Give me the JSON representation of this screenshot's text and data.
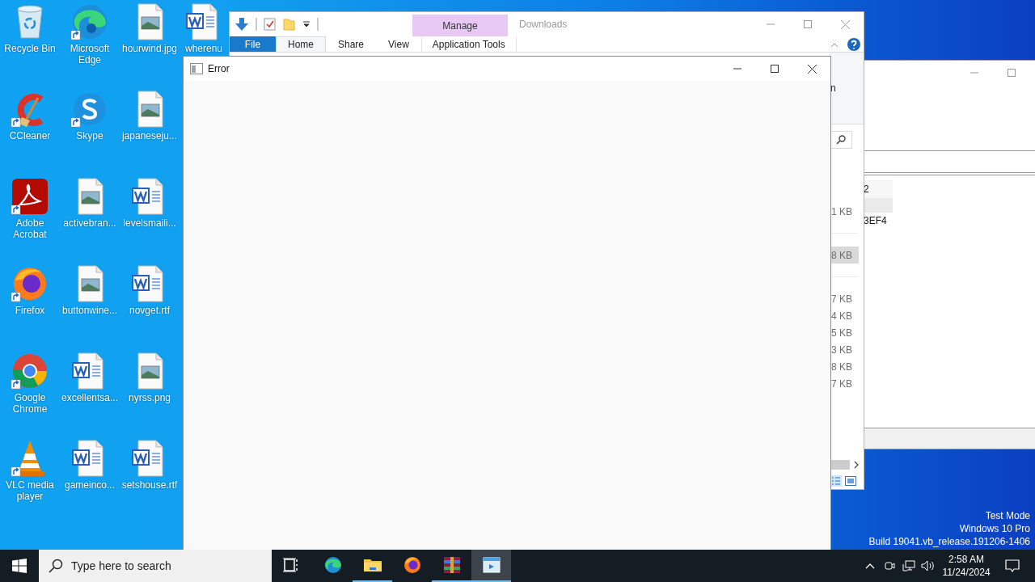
{
  "desktop": {
    "icons": [
      {
        "label": "Recycle Bin",
        "kind": "recycle",
        "shortcut": false
      },
      {
        "label": "CCleaner",
        "kind": "ccleaner",
        "shortcut": true
      },
      {
        "label": "Adobe Acrobat",
        "kind": "acrobat",
        "shortcut": true
      },
      {
        "label": "Firefox",
        "kind": "firefox",
        "shortcut": true
      },
      {
        "label": "Google Chrome",
        "kind": "chrome",
        "shortcut": true
      },
      {
        "label": "VLC media player",
        "kind": "vlc",
        "shortcut": true
      },
      {
        "label": "Microsoft Edge",
        "kind": "edge",
        "shortcut": true
      },
      {
        "label": "Skype",
        "kind": "skype",
        "shortcut": true
      },
      {
        "label": "activebran...",
        "kind": "image",
        "shortcut": false
      },
      {
        "label": "buttonwine...",
        "kind": "image",
        "shortcut": false
      },
      {
        "label": "excellentsa...",
        "kind": "word",
        "shortcut": false
      },
      {
        "label": "gameinco...",
        "kind": "word",
        "shortcut": false
      },
      {
        "label": "hourwind.jpg",
        "kind": "image",
        "shortcut": false
      },
      {
        "label": "japaneseju...",
        "kind": "image",
        "shortcut": false
      },
      {
        "label": "levelsmaili...",
        "kind": "word",
        "shortcut": false
      },
      {
        "label": "novget.rtf",
        "kind": "word",
        "shortcut": false
      },
      {
        "label": "nyrss.png",
        "kind": "image",
        "shortcut": false
      },
      {
        "label": "setshouse.rtf",
        "kind": "word",
        "shortcut": false
      },
      {
        "label": "wherenu",
        "kind": "word",
        "shortcut": false
      }
    ],
    "info": [
      "Test Mode",
      "Windows 10 Pro",
      "Build 19041.vb_release.191206-1406"
    ]
  },
  "explorer": {
    "context_tab": "Manage",
    "title": "Downloads",
    "tabs": [
      {
        "label": "File",
        "kind": "file",
        "selected": false
      },
      {
        "label": "Home",
        "kind": "plain",
        "selected": true
      },
      {
        "label": "Share",
        "kind": "plain",
        "selected": false
      },
      {
        "label": "View",
        "kind": "plain",
        "selected": false
      },
      {
        "label": "Application Tools",
        "kind": "context",
        "selected": false
      }
    ],
    "ribbon_text": "n",
    "size_groups": [
      [
        {
          "text": "1 KB",
          "selected": false
        }
      ],
      [
        {
          "text": "8 KB",
          "selected": true
        }
      ],
      [
        {
          "text": "7 KB",
          "selected": false
        },
        {
          "text": "4 KB",
          "selected": false
        },
        {
          "text": "5 KB",
          "selected": false
        },
        {
          "text": "3 KB",
          "selected": false
        },
        {
          "text": "8 KB",
          "selected": false
        },
        {
          "text": "7 KB",
          "selected": false
        }
      ]
    ]
  },
  "back_window": {
    "cells": [
      {
        "text": "2",
        "selected": false
      },
      {
        "selected": true
      },
      {
        "text": "3EF4",
        "selected": false
      }
    ]
  },
  "error_window": {
    "title": "Error"
  },
  "taskbar": {
    "search": {
      "placeholder": "Type here to search"
    },
    "apps": [
      {
        "kind": "taskview",
        "open": false,
        "active": false
      },
      {
        "kind": "edge",
        "open": false,
        "active": false
      },
      {
        "kind": "folder",
        "open": true,
        "active": false
      },
      {
        "kind": "firefox",
        "open": false,
        "active": false
      },
      {
        "kind": "archive",
        "open": true,
        "active": false
      },
      {
        "kind": "window",
        "open": true,
        "active": true
      }
    ],
    "time": "2:58 AM",
    "date": "11/24/2024"
  }
}
